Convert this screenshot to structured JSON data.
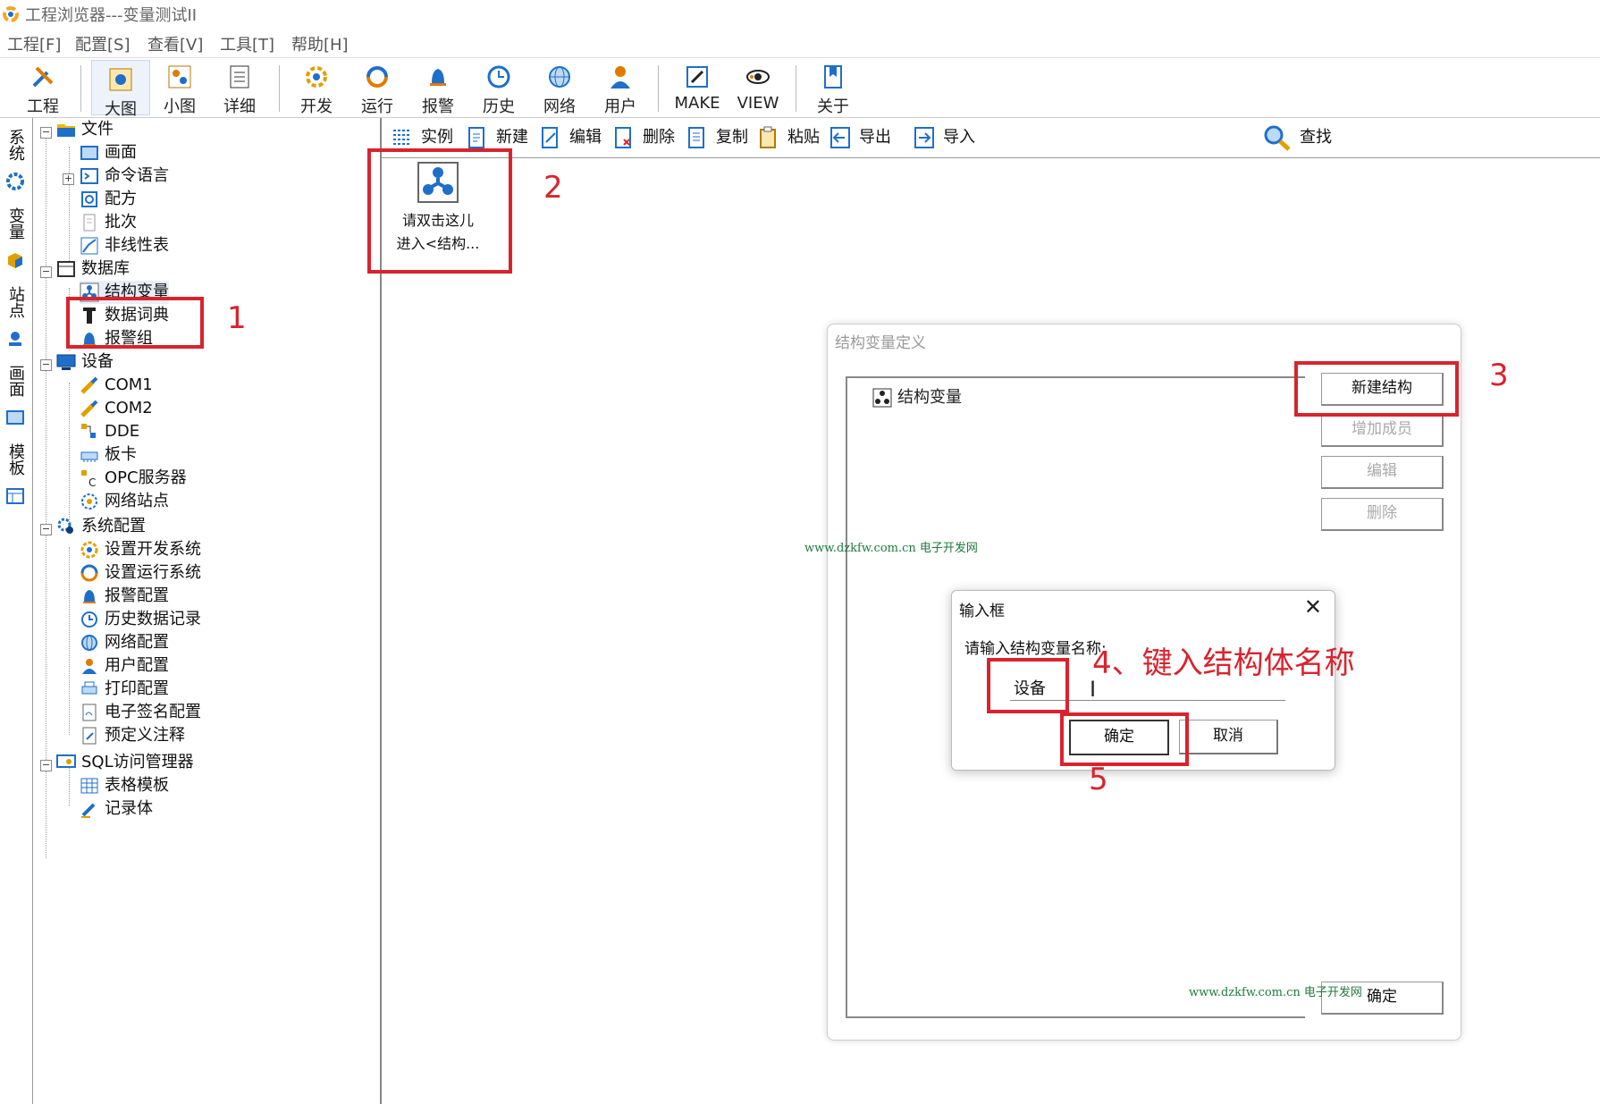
{
  "window": {
    "title": "工程浏览器---变量测试II"
  },
  "menu": [
    "工程[F]",
    "配置[S]",
    "查看[V]",
    "工具[T]",
    "帮助[H]"
  ],
  "toolbar": {
    "buttons": [
      "工程",
      "大图",
      "小图",
      "详细",
      "开发",
      "运行",
      "报警",
      "历史",
      "网络",
      "用户",
      "MAKE",
      "VIEW",
      "关于"
    ]
  },
  "vtabs": [
    "系统",
    "变量",
    "站点",
    "画面",
    "模板"
  ],
  "tree": {
    "file": "文件",
    "screen": "画面",
    "cmdlang": "命令语言",
    "recipe": "配方",
    "batch": "批次",
    "nonlinear": "非线性表",
    "database": "数据库",
    "struct_var": "结构变量",
    "data_dict": "数据词典",
    "alarm_group": "报警组",
    "device": "设备",
    "com1": "COM1",
    "com2": "COM2",
    "dde": "DDE",
    "board": "板卡",
    "opc": "OPC服务器",
    "netsite": "网络站点",
    "sysconfig": "系统配置",
    "dev_sys": "设置开发系统",
    "run_sys": "设置运行系统",
    "alarm_cfg": "报警配置",
    "history_rec": "历史数据记录",
    "net_cfg": "网络配置",
    "user_cfg": "用户配置",
    "print_cfg": "打印配置",
    "esign_cfg": "电子签名配置",
    "predef_note": "预定义注释",
    "sql_mgr": "SQL访问管理器",
    "table_tpl": "表格模板",
    "record": "记录体"
  },
  "content_toolbar": {
    "instance": "实例",
    "new": "新建",
    "edit": "编辑",
    "delete": "删除",
    "copy": "复制",
    "paste": "粘贴",
    "export": "导出",
    "import": "导入",
    "find": "查找"
  },
  "bigicon": {
    "line1": "请双击这儿",
    "line2": "进入<结构..."
  },
  "annotations": {
    "n1": "1",
    "n2": "2",
    "n3": "3",
    "n4": "4、键入结构体名称",
    "n5": "5"
  },
  "struct_dialog": {
    "title": "结构变量定义",
    "root": "结构变量",
    "new_struct": "新建结构",
    "add_member": "增加成员",
    "edit": "编辑",
    "delete": "删除",
    "ok": "确定"
  },
  "watermark": "www.dzkfw.com.cn 电子开发网",
  "input_dialog": {
    "title": "输入框",
    "prompt": "请输入结构变量名称:",
    "value": "设备",
    "ok": "确定",
    "cancel": "取消"
  },
  "colors": {
    "annotation_red": "#d9232e",
    "watermark_green": "#1e7a3c",
    "icon_blue": "#1f6fc9"
  }
}
